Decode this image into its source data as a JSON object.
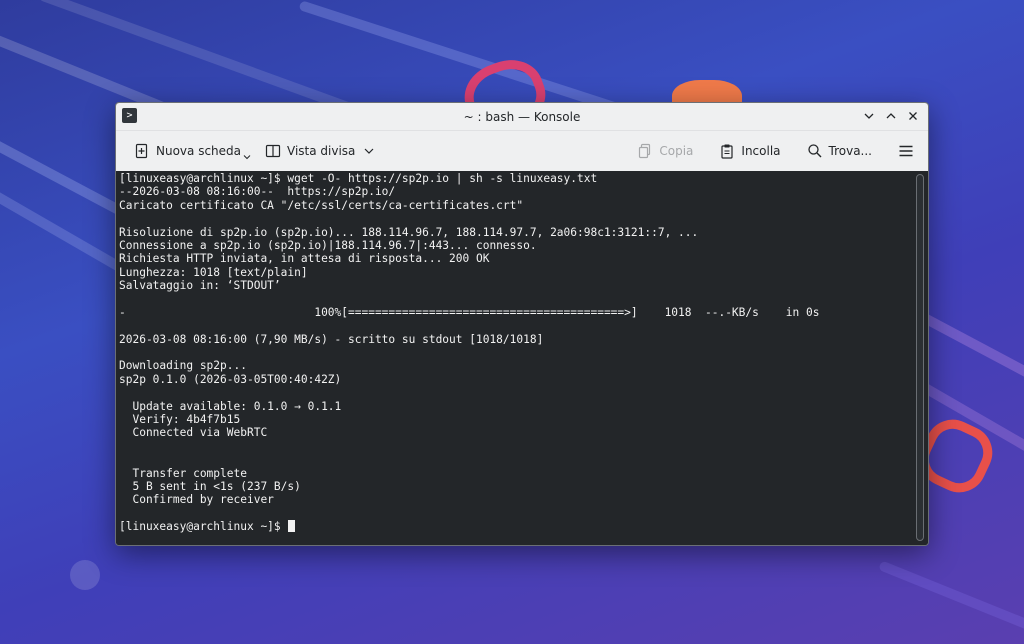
{
  "window": {
    "title": "~ : bash — Konsole",
    "app_icon": "terminal-icon"
  },
  "toolbar": {
    "new_tab_label": "Nuova scheda",
    "split_view_label": "Vista divisa",
    "copy_label": "Copia",
    "paste_label": "Incolla",
    "find_label": "Trova..."
  },
  "terminal": {
    "lines": [
      "[linuxeasy@archlinux ~]$ wget -O- https://sp2p.io | sh -s linuxeasy.txt",
      "--2026-03-08 08:16:00--  https://sp2p.io/",
      "Caricato certificato CA \"/etc/ssl/certs/ca-certificates.crt\"",
      "",
      "Risoluzione di sp2p.io (sp2p.io)... 188.114.96.7, 188.114.97.7, 2a06:98c1:3121::7, ...",
      "Connessione a sp2p.io (sp2p.io)|188.114.96.7|:443... connesso.",
      "Richiesta HTTP inviata, in attesa di risposta... 200 OK",
      "Lunghezza: 1018 [text/plain]",
      "Salvataggio in: ‘STDOUT’",
      "",
      "-                            100%[=========================================>]    1018  --.-KB/s    in 0s",
      "",
      "2026-03-08 08:16:00 (7,90 MB/s) - scritto su stdout [1018/1018]",
      "",
      "Downloading sp2p...",
      "sp2p 0.1.0 (2026-03-05T00:40:42Z)",
      "",
      "  Update available: 0.1.0 → 0.1.1",
      "  Verify: 4b4f7b15",
      "  Connected via WebRTC",
      "",
      "",
      "  Transfer complete",
      "  5 B sent in <1s (237 B/s)",
      "  Confirmed by receiver",
      "",
      "[linuxeasy@archlinux ~]$ "
    ]
  },
  "colors": {
    "terminal_bg": "#232629",
    "terminal_fg": "#f2f2f2",
    "chrome_bg": "#eff0f1"
  }
}
